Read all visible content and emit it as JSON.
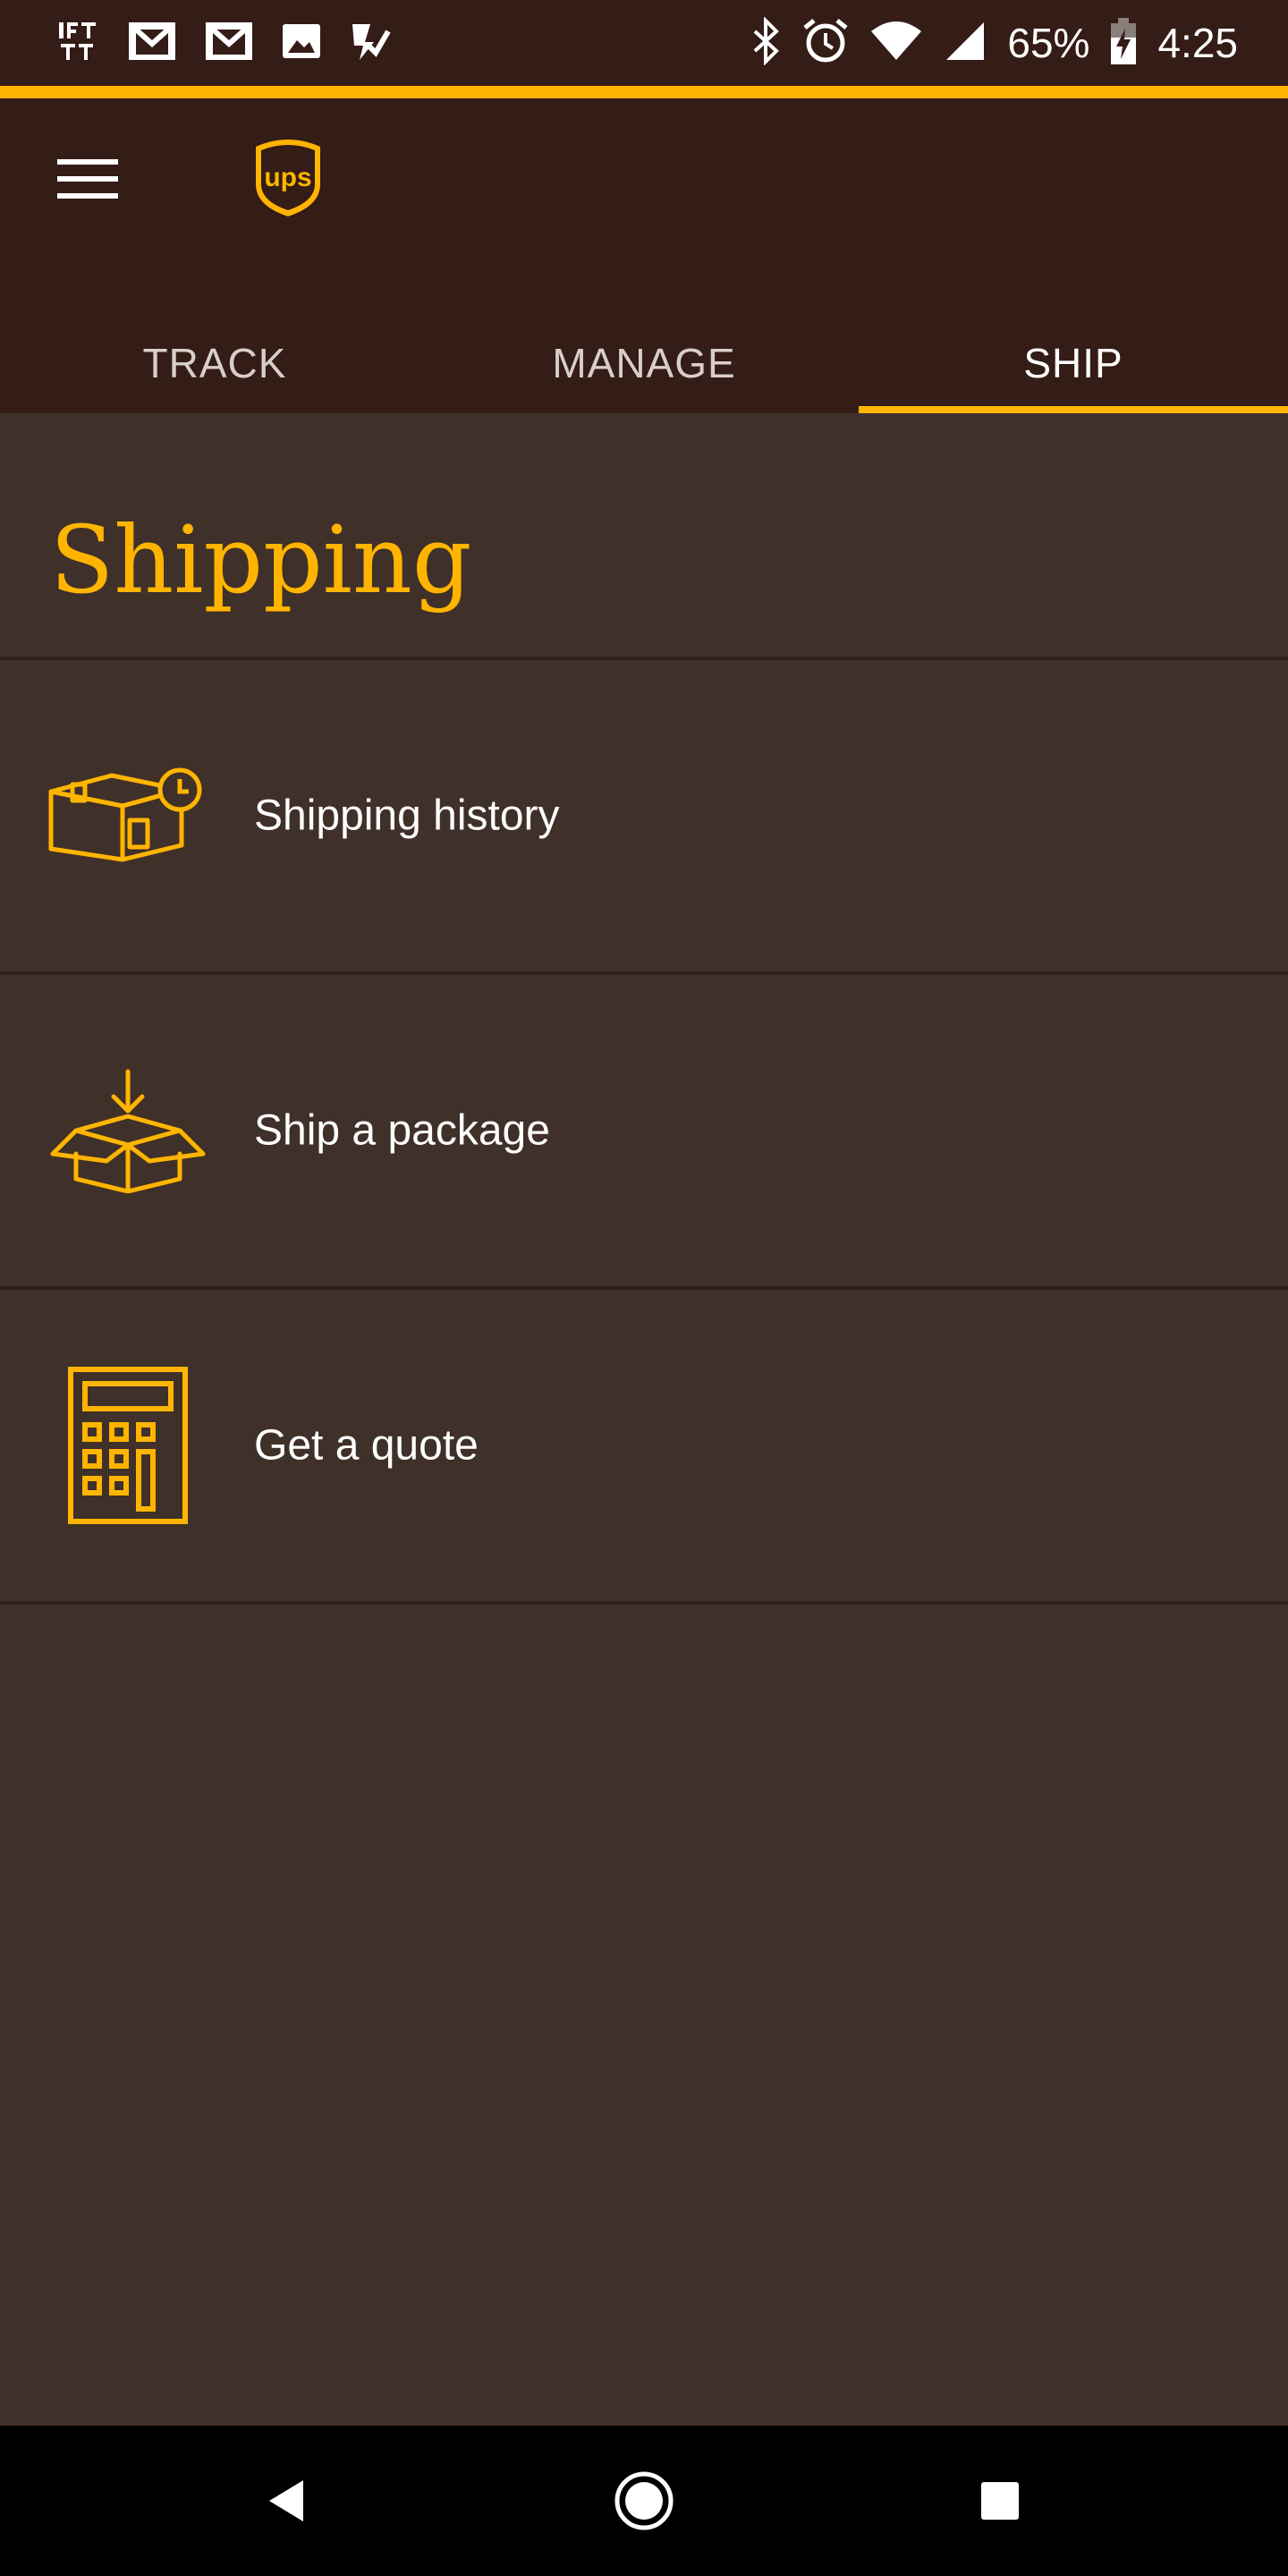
{
  "status_bar": {
    "battery_percent": "65%",
    "time": "4:25",
    "left_icons": [
      "ifttt-icon",
      "gmail-icon",
      "gmail-icon",
      "photo-icon",
      "tasks-icon"
    ],
    "right_icons": [
      "bluetooth-icon",
      "alarm-icon",
      "wifi-icon",
      "signal-icon",
      "battery-charging-icon"
    ]
  },
  "header": {
    "menu_icon": "hamburger-menu-icon",
    "logo": "ups-logo",
    "logo_text": "ups"
  },
  "tabs": [
    {
      "label": "TRACK",
      "active": false
    },
    {
      "label": "MANAGE",
      "active": false
    },
    {
      "label": "SHIP",
      "active": true
    }
  ],
  "main": {
    "title": "Shipping",
    "items": [
      {
        "label": "Shipping history",
        "icon": "package-history-icon"
      },
      {
        "label": "Ship a package",
        "icon": "open-box-icon"
      },
      {
        "label": "Get a quote",
        "icon": "calculator-icon"
      }
    ]
  },
  "nav_bar": {
    "buttons": [
      "back-icon",
      "home-icon",
      "recents-icon"
    ]
  },
  "colors": {
    "brand_brown": "#341c17",
    "content_bg": "#40302a",
    "accent_gold": "#ffb500"
  }
}
